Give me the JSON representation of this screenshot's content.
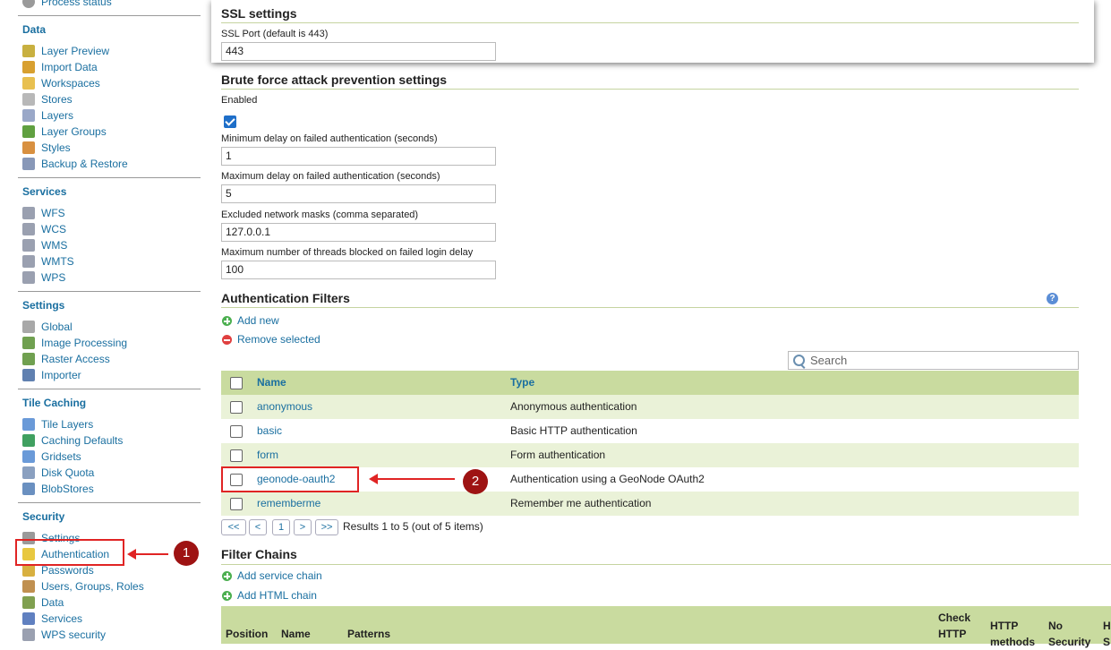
{
  "sidebar": {
    "top_partial": "Process status",
    "sections": [
      {
        "title": "Data",
        "items": [
          {
            "label": "Layer Preview",
            "icon": "layer-preview-icon",
            "color": "#c8b040"
          },
          {
            "label": "Import Data",
            "icon": "import-icon",
            "color": "#d8a030"
          },
          {
            "label": "Workspaces",
            "icon": "folder-icon",
            "color": "#e8c050"
          },
          {
            "label": "Stores",
            "icon": "store-icon",
            "color": "#b8b8b8"
          },
          {
            "label": "Layers",
            "icon": "layers-icon",
            "color": "#9aa8c8"
          },
          {
            "label": "Layer Groups",
            "icon": "layer-groups-icon",
            "color": "#60a040"
          },
          {
            "label": "Styles",
            "icon": "palette-icon",
            "color": "#d89040"
          },
          {
            "label": "Backup & Restore",
            "icon": "backup-icon",
            "color": "#8898b8"
          }
        ]
      },
      {
        "title": "Services",
        "items": [
          {
            "label": "WFS",
            "icon": "service-icon",
            "color": "#9aa0b0"
          },
          {
            "label": "WCS",
            "icon": "service-icon",
            "color": "#9aa0b0"
          },
          {
            "label": "WMS",
            "icon": "service-icon",
            "color": "#9aa0b0"
          },
          {
            "label": "WMTS",
            "icon": "service-icon",
            "color": "#9aa0b0"
          },
          {
            "label": "WPS",
            "icon": "service-icon",
            "color": "#9aa0b0"
          }
        ]
      },
      {
        "title": "Settings",
        "items": [
          {
            "label": "Global",
            "icon": "server-icon",
            "color": "#a8a8a8"
          },
          {
            "label": "Image Processing",
            "icon": "image-icon",
            "color": "#70a050"
          },
          {
            "label": "Raster Access",
            "icon": "raster-icon",
            "color": "#70a050"
          },
          {
            "label": "Importer",
            "icon": "importer-icon",
            "color": "#6080b0"
          }
        ]
      },
      {
        "title": "Tile Caching",
        "items": [
          {
            "label": "Tile Layers",
            "icon": "grid-icon",
            "color": "#6a9ad8"
          },
          {
            "label": "Caching Defaults",
            "icon": "globe-icon",
            "color": "#40a060"
          },
          {
            "label": "Gridsets",
            "icon": "grid-icon",
            "color": "#6a9ad8"
          },
          {
            "label": "Disk Quota",
            "icon": "disk-icon",
            "color": "#8aa0c0"
          },
          {
            "label": "BlobStores",
            "icon": "blobstore-icon",
            "color": "#6a90c0"
          }
        ]
      },
      {
        "title": "Security",
        "items": [
          {
            "label": "Settings",
            "icon": "wrench-icon",
            "color": "#9a9a9a"
          },
          {
            "label": "Authentication",
            "icon": "shield-icon",
            "color": "#e8c840"
          },
          {
            "label": "Passwords",
            "icon": "lock-icon",
            "color": "#d8b040"
          },
          {
            "label": "Users, Groups, Roles",
            "icon": "users-icon",
            "color": "#c09050"
          },
          {
            "label": "Data",
            "icon": "data-security-icon",
            "color": "#80a050"
          },
          {
            "label": "Services",
            "icon": "services-security-icon",
            "color": "#6080c0"
          },
          {
            "label": "WPS security",
            "icon": "wps-security-icon",
            "color": "#9aa0b0"
          }
        ]
      }
    ]
  },
  "ssl": {
    "title": "SSL settings",
    "port_label": "SSL Port (default is 443)",
    "port_value": "443"
  },
  "brute": {
    "title": "Brute force attack prevention settings",
    "enabled_label": "Enabled",
    "min_label": "Minimum delay on failed authentication (seconds)",
    "min_value": "1",
    "max_label": "Maximum delay on failed authentication (seconds)",
    "max_value": "5",
    "masks_label": "Excluded network masks (comma separated)",
    "masks_value": "127.0.0.1",
    "threads_label": "Maximum number of threads blocked on failed login delay",
    "threads_value": "100"
  },
  "filters": {
    "title": "Authentication Filters",
    "add_new": "Add new",
    "remove_selected": "Remove selected",
    "search_placeholder": "Search",
    "col_name": "Name",
    "col_type": "Type",
    "rows": [
      {
        "name": "anonymous",
        "type": "Anonymous authentication"
      },
      {
        "name": "basic",
        "type": "Basic HTTP authentication"
      },
      {
        "name": "form",
        "type": "Form authentication"
      },
      {
        "name": "geonode-oauth2",
        "type": "Authentication using a GeoNode OAuth2"
      },
      {
        "name": "rememberme",
        "type": "Remember me authentication"
      }
    ],
    "pager": {
      "first": "<<",
      "prev": "<",
      "page": "1",
      "next": ">",
      "last": ">>",
      "summary": "Results 1 to 5 (out of 5 items)"
    }
  },
  "chains": {
    "title": "Filter Chains",
    "add_service": "Add service chain",
    "add_html": "Add HTML chain",
    "cols": {
      "position": "Position",
      "name": "Name",
      "patterns": "Patterns",
      "check_http": "Check HTTP",
      "http_methods": "HTTP methods",
      "no_security": "No Security",
      "h": "H S"
    }
  },
  "annotations": {
    "badge1": "1",
    "badge2": "2",
    "help": "?"
  }
}
